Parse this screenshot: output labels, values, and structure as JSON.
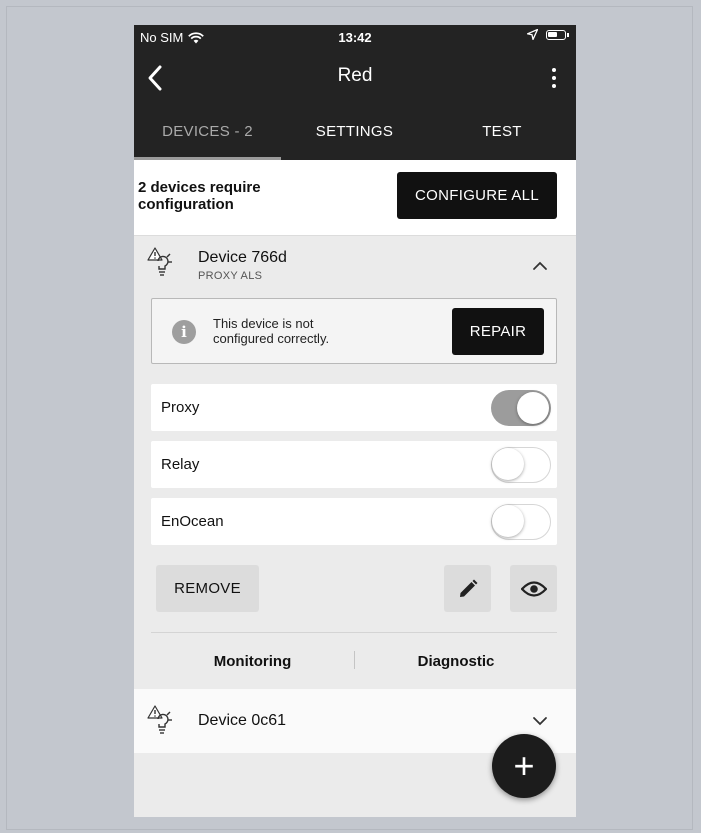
{
  "status_bar": {
    "carrier": "No SIM",
    "time": "13:42"
  },
  "nav": {
    "title": "Red"
  },
  "tabs": [
    {
      "label": "DEVICES - 2"
    },
    {
      "label": "SETTINGS"
    },
    {
      "label": "TEST"
    }
  ],
  "config": {
    "message": "2 devices require configuration",
    "button": "CONFIGURE ALL"
  },
  "device1": {
    "name": "Device 766d",
    "type": "PROXY ALS",
    "warning": "This device is not configured correctly.",
    "repair_button": "REPAIR",
    "toggles": [
      {
        "label": "Proxy",
        "on": true
      },
      {
        "label": "Relay",
        "on": false
      },
      {
        "label": "EnOcean",
        "on": false
      }
    ],
    "remove_button": "REMOVE",
    "links": {
      "monitoring": "Monitoring",
      "diagnostic": "Diagnostic"
    }
  },
  "device2": {
    "name": "Device 0c61"
  },
  "fab": {
    "symbol": "+"
  },
  "colors": {
    "header_bg": "#232323",
    "panel_bg": "#ebebeb",
    "button_dark": "#111111",
    "switch_on": "#9c9c9c"
  }
}
